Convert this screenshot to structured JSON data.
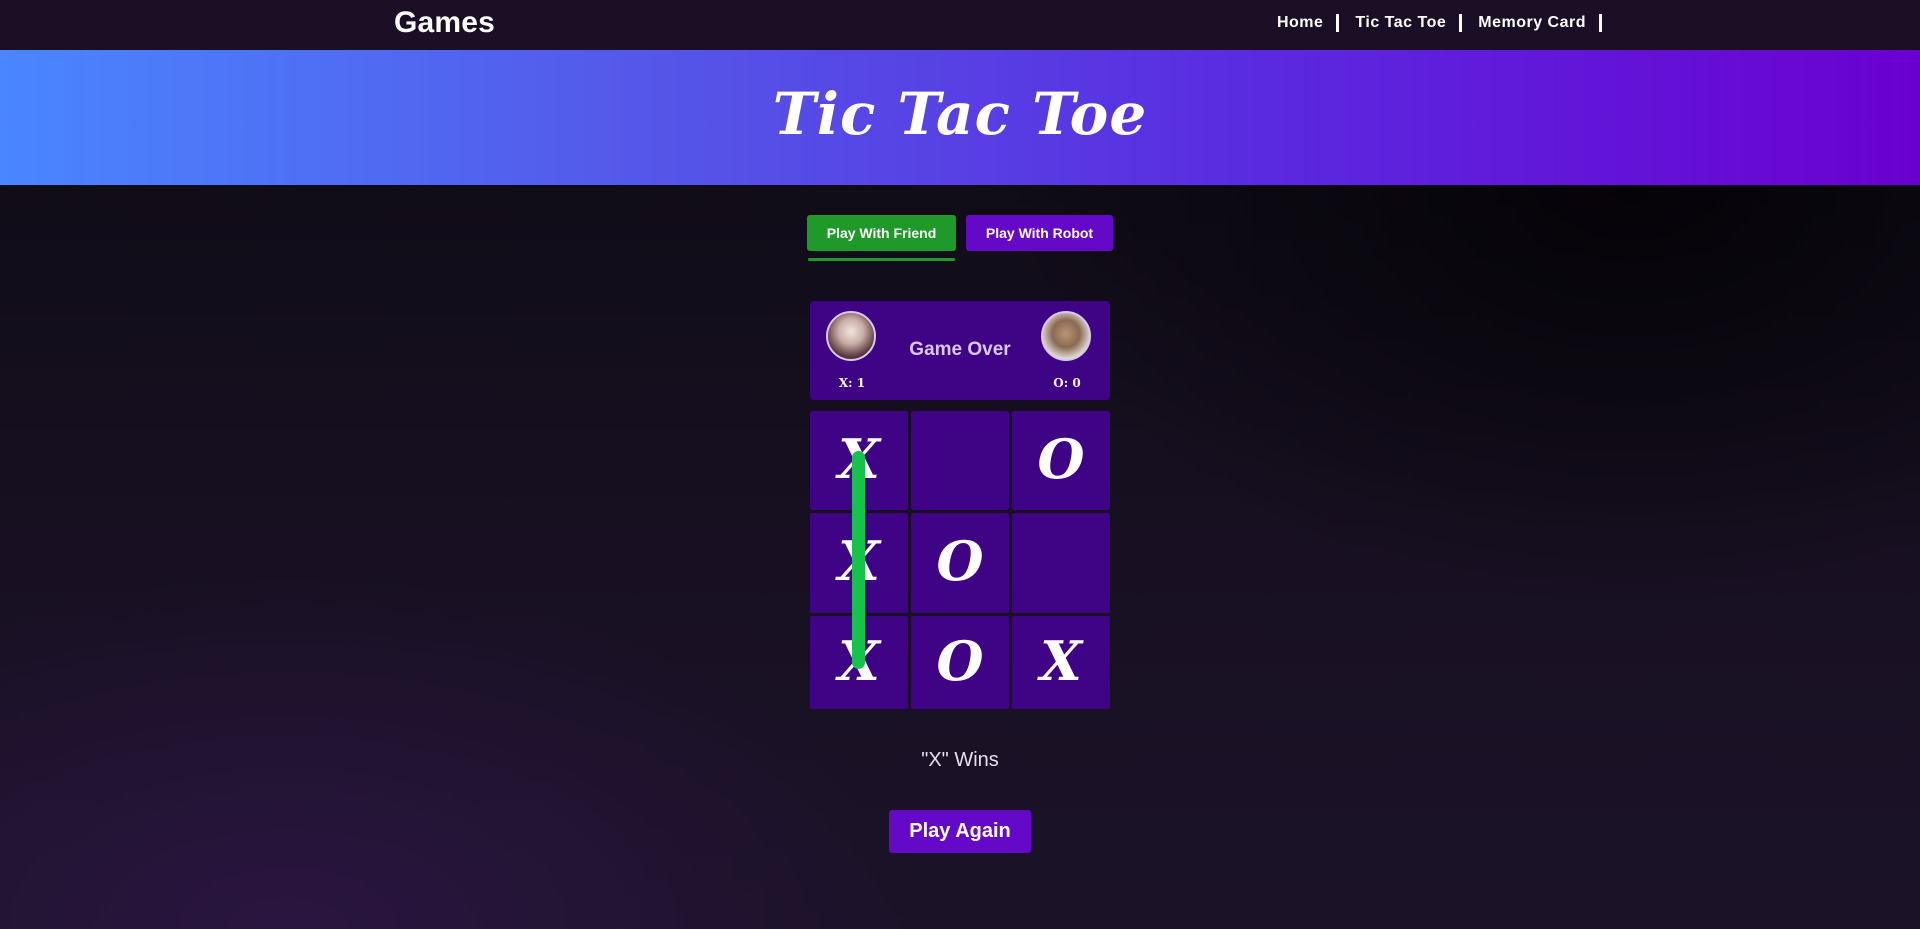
{
  "navbar": {
    "brand": "Games",
    "links": [
      {
        "label": "Home"
      },
      {
        "label": "Tic Tac Toe"
      },
      {
        "label": "Memory Card"
      }
    ]
  },
  "banner": {
    "title": "Tic Tac Toe"
  },
  "modes": {
    "friend_label": "Play With Friend",
    "robot_label": "Play With Robot",
    "active": "friend"
  },
  "scoreboard": {
    "status": "Game Over",
    "x_score": "X: 1",
    "o_score": "O: 0"
  },
  "board": {
    "cells": [
      "X",
      "",
      "O",
      "X",
      "O",
      "",
      "X",
      "O",
      "X"
    ],
    "winning_line": "left column"
  },
  "result": {
    "message": "\"X\" Wins",
    "play_again_label": "Play Again"
  },
  "colors": {
    "accent_purple": "#6509c8",
    "board_purple": "#3f0385",
    "friend_green": "#1f9a2a",
    "win_line_green": "#16c24a"
  }
}
